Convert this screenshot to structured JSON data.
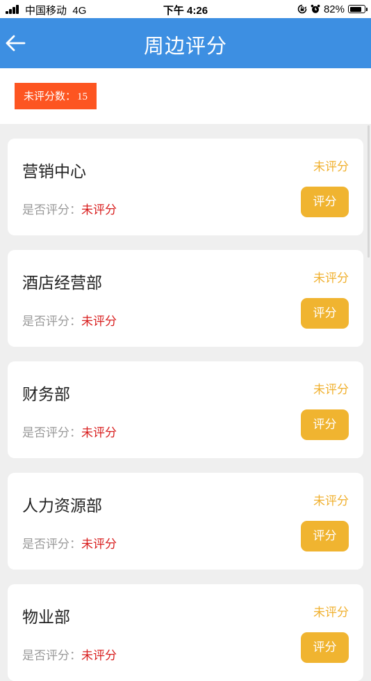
{
  "status_bar": {
    "carrier": "中国移动",
    "network": "4G",
    "time": "下午 4:26",
    "battery_percent_label": "82%",
    "battery_level": 0.82
  },
  "nav": {
    "title": "周边评分",
    "back_icon": "arrow-left-icon"
  },
  "summary": {
    "label": "未评分数：",
    "count": "15"
  },
  "departments": [
    {
      "name": "营销中心",
      "question_label": "是否评分：",
      "question_value": "未评分",
      "status": "未评分",
      "button": "评分"
    },
    {
      "name": "酒店经营部",
      "question_label": "是否评分：",
      "question_value": "未评分",
      "status": "未评分",
      "button": "评分"
    },
    {
      "name": "财务部",
      "question_label": "是否评分：",
      "question_value": "未评分",
      "status": "未评分",
      "button": "评分"
    },
    {
      "name": "人力资源部",
      "question_label": "是否评分：",
      "question_value": "未评分",
      "status": "未评分",
      "button": "评分"
    },
    {
      "name": "物业部",
      "question_label": "是否评分：",
      "question_value": "未评分",
      "status": "未评分",
      "button": "评分"
    }
  ],
  "colors": {
    "nav_bg": "#3d8fe2",
    "badge_bg": "#fd5521",
    "button_bg": "#f0b430",
    "status_text": "#f0b02e",
    "value_red": "#d81e1e"
  }
}
